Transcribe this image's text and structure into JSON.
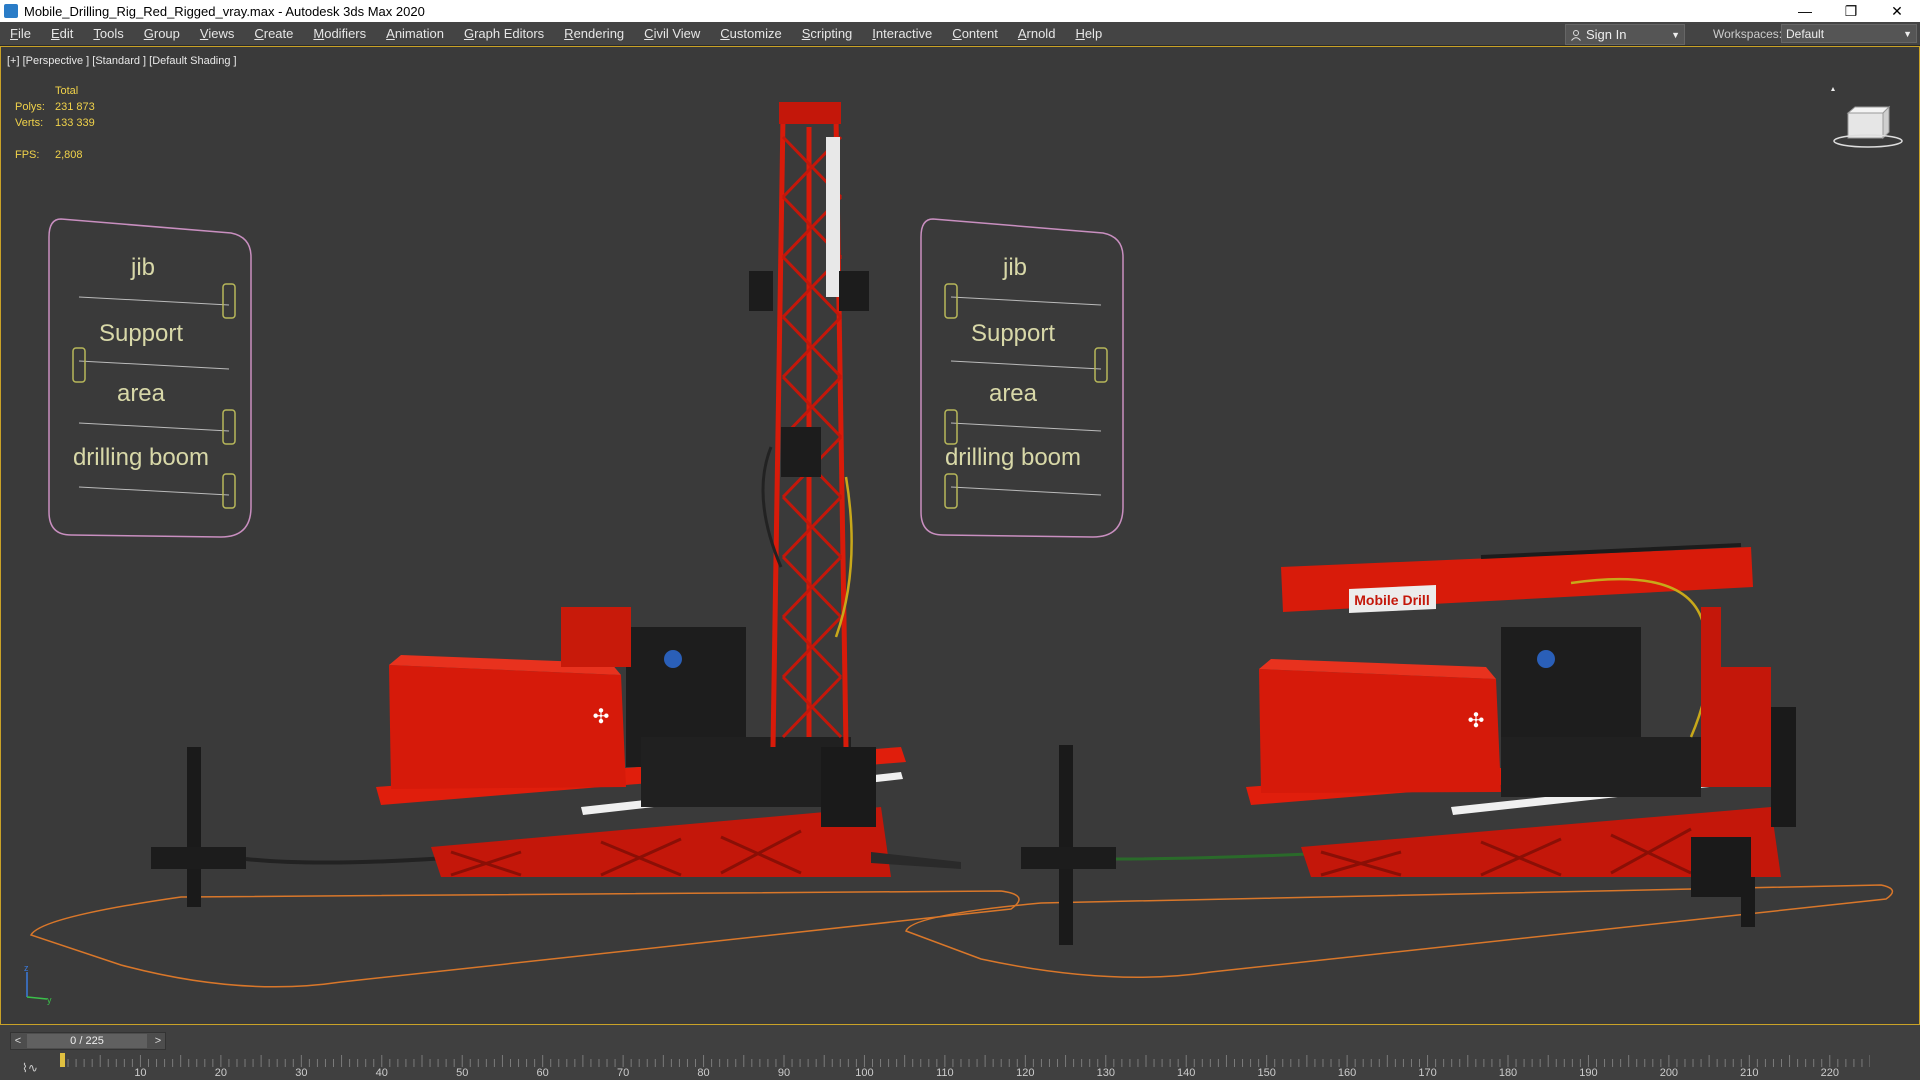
{
  "window": {
    "title": "Mobile_Drilling_Rig_Red_Rigged_vray.max - Autodesk 3ds Max 2020",
    "minimize_glyph": "—",
    "restore_glyph": "❐",
    "close_glyph": "✕"
  },
  "menu": {
    "items": [
      "File",
      "Edit",
      "Tools",
      "Group",
      "Views",
      "Create",
      "Modifiers",
      "Animation",
      "Graph Editors",
      "Rendering",
      "Civil View",
      "Customize",
      "Scripting",
      "Interactive",
      "Content",
      "Arnold",
      "Help"
    ]
  },
  "account": {
    "sign_in_label": "Sign In"
  },
  "workspaces": {
    "label": "Workspaces:",
    "value": "Default"
  },
  "viewport": {
    "label": "[+] [Perspective ] [Standard ] [Default Shading ]",
    "stats": {
      "header": "Total",
      "polys_label": "Polys:",
      "polys_value": "231 873",
      "verts_label": "Verts:",
      "verts_value": "133 339",
      "fps_label": "FPS:",
      "fps_value": "2,808"
    },
    "control_panel_left": {
      "labels": [
        "jib",
        "Support",
        "area",
        "drilling boom"
      ],
      "slider_levels": [
        1.0,
        0.0,
        1.0,
        1.0
      ]
    },
    "control_panel_right": {
      "labels": [
        "jib",
        "Support",
        "area",
        "drilling boom"
      ],
      "slider_levels": [
        0.0,
        1.0,
        0.0,
        0.0
      ]
    },
    "rig_logo_text": "Mobile Drill",
    "colors": {
      "rig_red": "#d41a0a",
      "border_active": "#c9a227",
      "panel_outline": "#c98fc0",
      "stats_yellow": "#f0d24a"
    }
  },
  "timeline": {
    "slider_text": "0 / 225",
    "prev_glyph": "<",
    "next_glyph": ">",
    "ruler_ticks": [
      "10",
      "20",
      "30",
      "40",
      "50",
      "60",
      "70",
      "80",
      "90",
      "100",
      "110",
      "120",
      "130",
      "140",
      "150",
      "160",
      "170",
      "180",
      "190",
      "200",
      "210",
      "220"
    ],
    "current_frame": 0,
    "total_frames": 225
  }
}
